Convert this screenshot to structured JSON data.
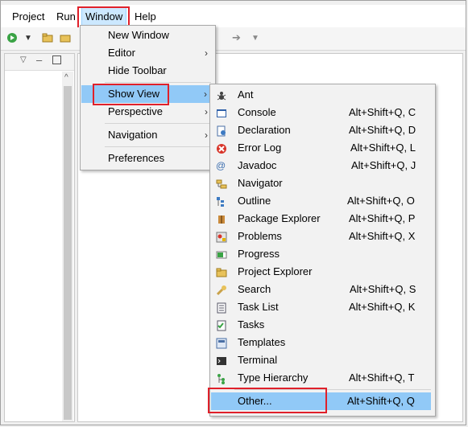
{
  "menubar": {
    "items": [
      "Project",
      "Run",
      "Window",
      "Help"
    ]
  },
  "window_menu": {
    "items": [
      {
        "label": "New Window",
        "submenu": false
      },
      {
        "label": "Editor",
        "submenu": true
      },
      {
        "label": "Hide Toolbar",
        "submenu": false
      },
      {
        "label": "Show View",
        "submenu": true,
        "highlighted": true
      },
      {
        "label": "Perspective",
        "submenu": true
      },
      {
        "label": "Navigation",
        "submenu": true
      },
      {
        "label": "Preferences",
        "submenu": false
      }
    ]
  },
  "show_view_menu": {
    "items": [
      {
        "label": "Ant",
        "shortcut": "",
        "icon": "ant-icon"
      },
      {
        "label": "Console",
        "shortcut": "Alt+Shift+Q, C",
        "icon": "console-icon"
      },
      {
        "label": "Declaration",
        "shortcut": "Alt+Shift+Q, D",
        "icon": "declaration-icon"
      },
      {
        "label": "Error Log",
        "shortcut": "Alt+Shift+Q, L",
        "icon": "error-log-icon"
      },
      {
        "label": "Javadoc",
        "shortcut": "Alt+Shift+Q, J",
        "icon": "javadoc-icon"
      },
      {
        "label": "Navigator",
        "shortcut": "",
        "icon": "navigator-icon"
      },
      {
        "label": "Outline",
        "shortcut": "Alt+Shift+Q, O",
        "icon": "outline-icon"
      },
      {
        "label": "Package Explorer",
        "shortcut": "Alt+Shift+Q, P",
        "icon": "package-explorer-icon"
      },
      {
        "label": "Problems",
        "shortcut": "Alt+Shift+Q, X",
        "icon": "problems-icon"
      },
      {
        "label": "Progress",
        "shortcut": "",
        "icon": "progress-icon"
      },
      {
        "label": "Project Explorer",
        "shortcut": "",
        "icon": "project-explorer-icon"
      },
      {
        "label": "Search",
        "shortcut": "Alt+Shift+Q, S",
        "icon": "search-icon"
      },
      {
        "label": "Task List",
        "shortcut": "Alt+Shift+Q, K",
        "icon": "task-list-icon"
      },
      {
        "label": "Tasks",
        "shortcut": "",
        "icon": "tasks-icon"
      },
      {
        "label": "Templates",
        "shortcut": "",
        "icon": "templates-icon"
      },
      {
        "label": "Terminal",
        "shortcut": "",
        "icon": "terminal-icon"
      },
      {
        "label": "Type Hierarchy",
        "shortcut": "Alt+Shift+Q, T",
        "icon": "type-hierarchy-icon"
      },
      {
        "label": "Other...",
        "shortcut": "Alt+Shift+Q, Q",
        "icon": "",
        "highlighted": true
      }
    ]
  },
  "colors": {
    "highlight": "#91c9f7",
    "annotation_box": "#e0202a"
  }
}
